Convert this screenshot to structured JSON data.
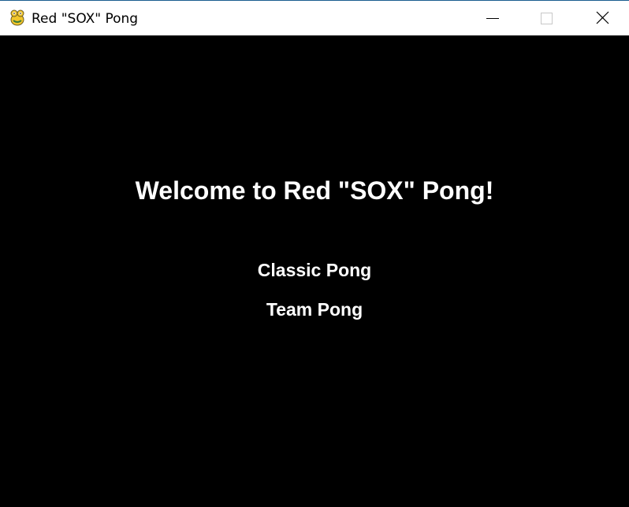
{
  "window": {
    "title": "Red \"SOX\" Pong",
    "icon": "pygame-snake-icon",
    "controls": [
      "minimize-icon",
      "maximize-icon",
      "close-icon"
    ]
  },
  "game": {
    "welcome_text": "Welcome to Red \"SOX\" Pong!",
    "menu": [
      {
        "label": "Classic Pong"
      },
      {
        "label": "Team Pong"
      }
    ]
  },
  "colors": {
    "background": "#000000",
    "text": "#ffffff",
    "titlebar": "#ffffff"
  }
}
